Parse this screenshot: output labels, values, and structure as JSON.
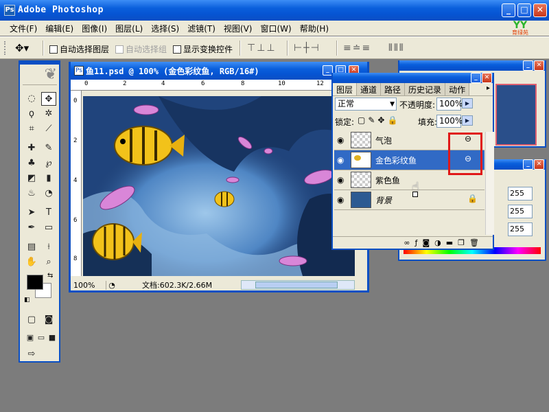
{
  "app": {
    "title": "Adobe Photoshop",
    "icon": "photoshop-icon"
  },
  "logo": {
    "text": "YY",
    "subtitle": "育绿苑"
  },
  "menu": {
    "items": [
      "文件(F)",
      "编辑(E)",
      "图像(I)",
      "图层(L)",
      "选择(S)",
      "滤镜(T)",
      "视图(V)",
      "窗口(W)",
      "帮助(H)"
    ]
  },
  "options": {
    "auto_select_layer": "自动选择图层",
    "auto_select_group": "自动选择组",
    "show_transform": "显示变换控件"
  },
  "document": {
    "title": "鱼11.psd @ 100% (金色彩纹鱼, RGB/16#)",
    "zoom": "100%",
    "doc_size": "文档:602.3K/2.66M",
    "ruler_h": [
      "0",
      "2",
      "4",
      "6",
      "8",
      "10",
      "12"
    ],
    "ruler_v": [
      "0",
      "2",
      "4",
      "6",
      "8"
    ]
  },
  "layers_panel": {
    "tabs": [
      "图层",
      "通道",
      "路径",
      "历史记录",
      "动作"
    ],
    "blend_mode": "正常",
    "opacity_label": "不透明度:",
    "opacity_value": "100%",
    "lock_label": "锁定:",
    "fill_label": "填充:",
    "fill_value": "100%",
    "layers": [
      {
        "name": "气泡",
        "linked": true,
        "selected": false
      },
      {
        "name": "金色彩纹鱼",
        "linked": true,
        "selected": true
      },
      {
        "name": "紫色鱼",
        "linked": false,
        "selected": false
      },
      {
        "name": "背景",
        "linked": false,
        "selected": false,
        "locked": true
      }
    ]
  },
  "color_panel": {
    "values": [
      "255",
      "255",
      "255"
    ]
  },
  "colors": {
    "xp_blue": "#0a4fc4",
    "highlight_red": "#e01818",
    "selected_layer": "#316ac5"
  }
}
